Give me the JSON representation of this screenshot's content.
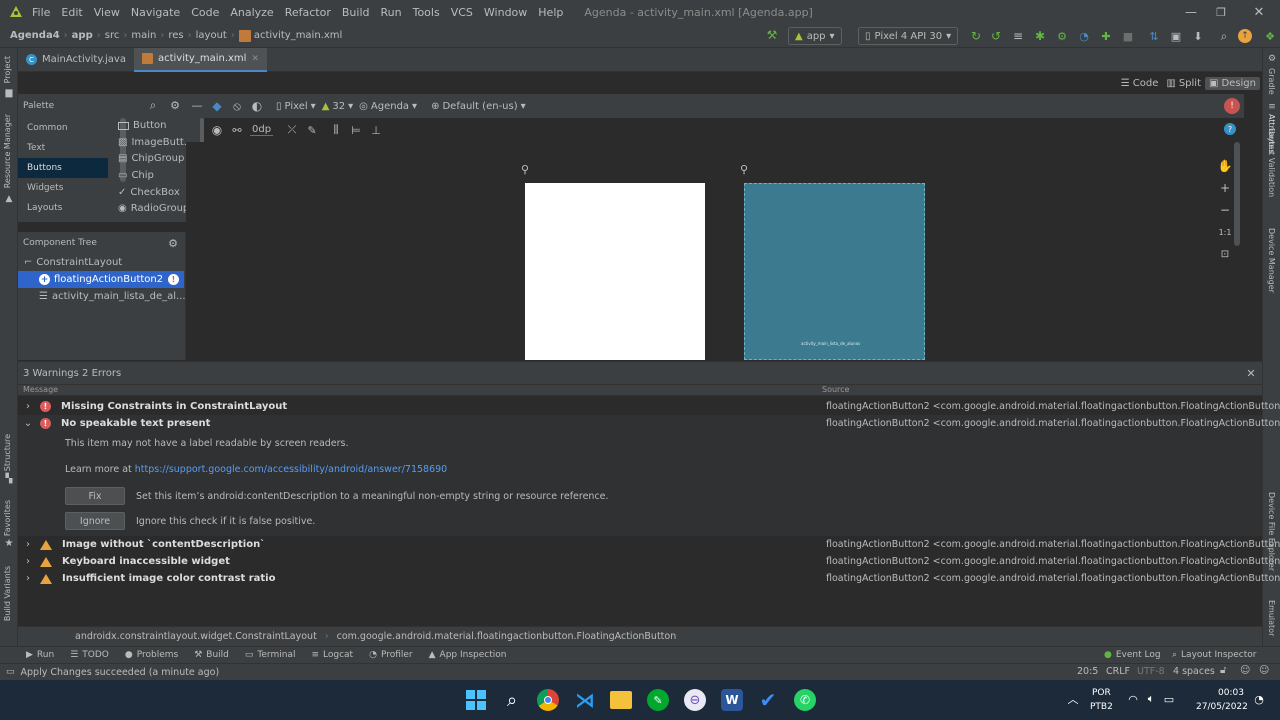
{
  "menu": {
    "items": [
      "File",
      "Edit",
      "View",
      "Navigate",
      "Code",
      "Analyze",
      "Refactor",
      "Build",
      "Run",
      "Tools",
      "VCS",
      "Window",
      "Help"
    ],
    "window_title": "Agenda - activity_main.xml [Agenda.app]"
  },
  "breadcrumb": {
    "project": "Agenda4",
    "items": [
      "app",
      "src",
      "main",
      "res",
      "layout",
      "activity_main.xml"
    ]
  },
  "toolbar": {
    "run_config": "app",
    "device": "Pixel 4 API 30"
  },
  "tabs": [
    {
      "label": "MainActivity.java"
    },
    {
      "label": "activity_main.xml"
    }
  ],
  "view_modes": {
    "code": "Code",
    "split": "Split",
    "design": "Design"
  },
  "palette": {
    "title": "Palette",
    "categories": [
      "Common",
      "Text",
      "Buttons",
      "Widgets",
      "Layouts"
    ],
    "items": [
      "Button",
      "ImageButt...",
      "ChipGroup",
      "Chip",
      "CheckBox",
      "RadioGroup"
    ]
  },
  "design_toolbar": {
    "device": "Pixel",
    "api": "32",
    "theme": "Agenda",
    "locale": "Default (en-us)",
    "margin": "0dp"
  },
  "component_tree": {
    "title": "Component Tree",
    "nodes": [
      "ConstraintLayout",
      "floatingActionButton2",
      "activity_main_lista_de_al..."
    ]
  },
  "canvas": {
    "blueprint_label": "activity_main_lista_de_alunos",
    "zoom_reset": "1:1"
  },
  "side_labels": {
    "left": [
      "Project",
      "Resource Manager",
      "Structure",
      "Favorites",
      "Build Variants"
    ],
    "right": [
      "Gradle",
      "Attributes",
      "Layout Validation",
      "Device Manager",
      "Device File Explorer",
      "Emulator"
    ]
  },
  "problems": {
    "header": "3 Warnings 2 Errors",
    "col_message": "Message",
    "col_source": "Source",
    "source_text": "floatingActionButton2 <com.google.android.material.floatingactionbutton.FloatingActionButton>",
    "issues": [
      {
        "severity": "error",
        "message": "Missing Constraints in ConstraintLayout"
      },
      {
        "severity": "error",
        "message": "No speakable text present"
      },
      {
        "severity": "warning",
        "message": "Image without `contentDescription`"
      },
      {
        "severity": "warning",
        "message": "Keyboard inaccessible widget"
      },
      {
        "severity": "warning",
        "message": "Insufficient image color contrast ratio"
      }
    ],
    "detail": {
      "description": "This item may not have a label readable by screen readers.",
      "learn_more_prefix": "Learn more at ",
      "learn_more_url": "https://support.google.com/accessibility/android/answer/7158690",
      "fix_button": "Fix",
      "fix_text": "Set this item’s android:contentDescription to a meaningful non-empty string or resource reference.",
      "ignore_button": "Ignore",
      "ignore_text": "Ignore this check if it is false positive."
    }
  },
  "class_path": [
    "androidx.constraintlayout.widget.ConstraintLayout",
    "com.google.android.material.floatingactionbutton.FloatingActionButton"
  ],
  "tool_tabs": [
    "Run",
    "TODO",
    "Problems",
    "Build",
    "Terminal",
    "Logcat",
    "Profiler",
    "App Inspection"
  ],
  "tool_tabs_right": [
    "Event Log",
    "Layout Inspector"
  ],
  "status": {
    "message": "Apply Changes succeeded (a minute ago)",
    "position": "20:5",
    "line_sep": "CRLF",
    "encoding": "UTF-8",
    "indent": "4 spaces"
  },
  "taskbar": {
    "lang_top": "POR",
    "lang_bottom": "PTB2",
    "time": "00:03",
    "date": "27/05/2022"
  },
  "colors": {
    "accent": "#4a88c7",
    "error": "#db5c5c",
    "warning": "#e8a33e",
    "blueprint": "#3b7a8f"
  }
}
